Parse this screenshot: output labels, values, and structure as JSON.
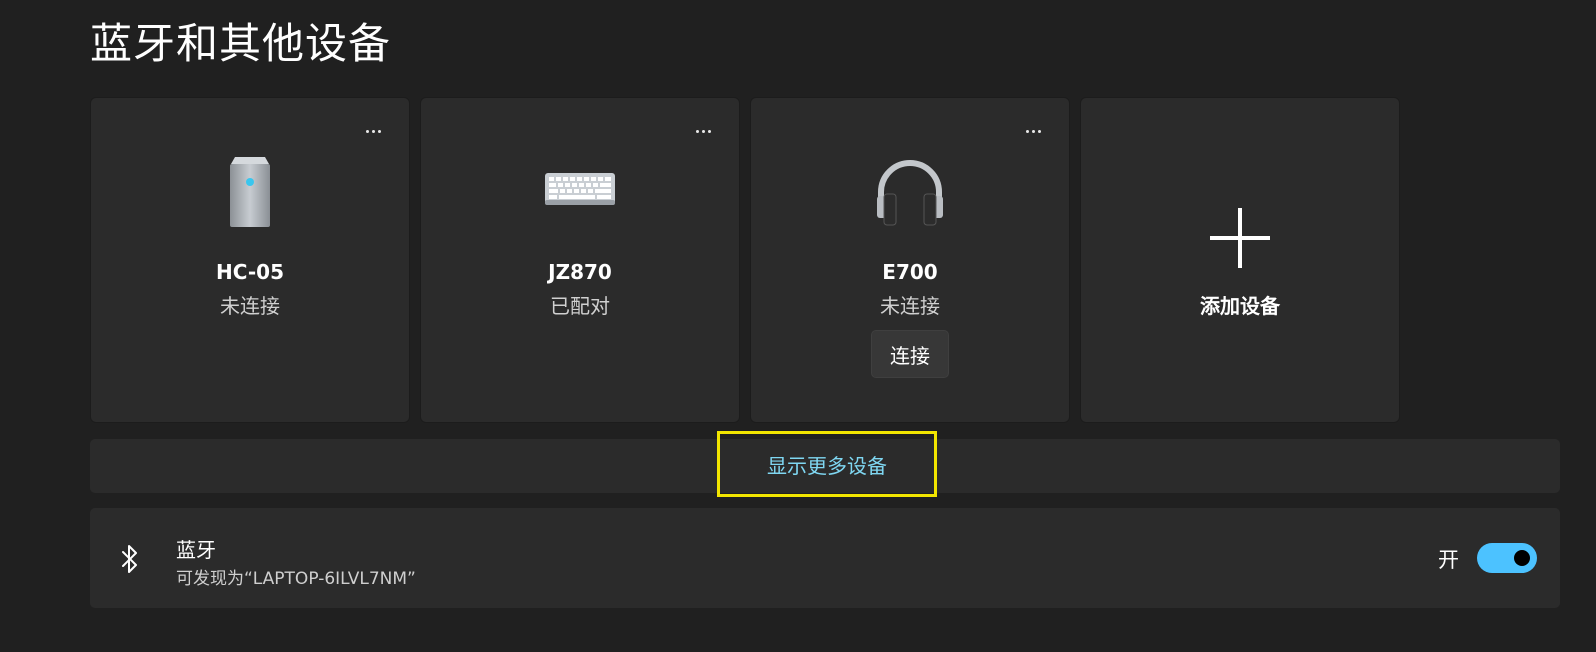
{
  "page": {
    "title": "蓝牙和其他设备"
  },
  "devices": [
    {
      "name": "HC-05",
      "status": "未连接",
      "icon": "device-tower-icon"
    },
    {
      "name": "JZ870",
      "status": "已配对",
      "icon": "keyboard-icon"
    },
    {
      "name": "E700",
      "status": "未连接",
      "icon": "headphones-icon",
      "action_label": "连接"
    }
  ],
  "add_device": {
    "label": "添加设备",
    "icon": "plus-icon"
  },
  "show_more": {
    "label": "显示更多设备",
    "highlight_color": "#f2e500",
    "text_color": "#7fd7f2"
  },
  "bluetooth": {
    "title": "蓝牙",
    "subtitle": "可发现为“LAPTOP-6ILVL7NM”",
    "toggle_label": "开",
    "toggle_on": true,
    "accent_color": "#4cc2ff",
    "icon": "bluetooth-icon"
  }
}
